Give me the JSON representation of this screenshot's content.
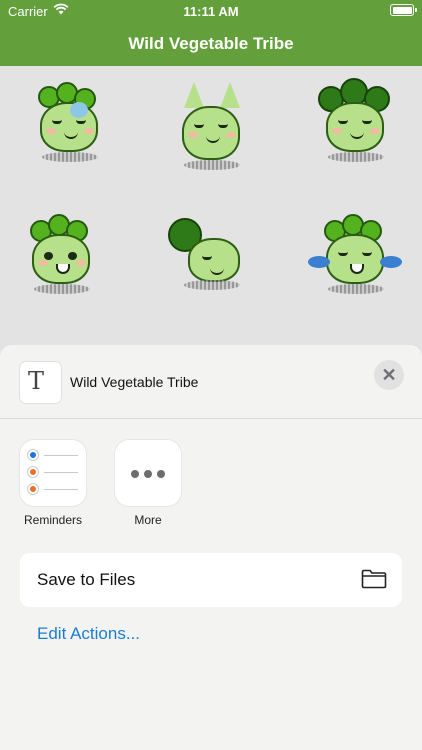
{
  "status_bar": {
    "carrier": "Carrier",
    "time": "11:11 AM"
  },
  "nav": {
    "title": "Wild Vegetable Tribe",
    "background": "#63a03b"
  },
  "stickers": [
    {
      "name": "sticker-curly-bubble"
    },
    {
      "name": "sticker-cat-ears"
    },
    {
      "name": "sticker-broccoli-afro"
    },
    {
      "name": "sticker-curly-happy"
    },
    {
      "name": "sticker-broccoli-side"
    },
    {
      "name": "sticker-curly-crying"
    }
  ],
  "share_sheet": {
    "document_title": "Wild Vegetable Tribe",
    "document_icon": "text-document-icon",
    "close_icon": "close-icon",
    "apps": [
      {
        "label": "Reminders",
        "icon": "reminders-icon"
      },
      {
        "label": "More",
        "icon": "more-icon"
      }
    ],
    "actions": [
      {
        "label": "Save to Files",
        "icon": "folder-icon"
      }
    ],
    "edit_actions_label": "Edit Actions...",
    "accent_color": "#1c7cd5"
  }
}
